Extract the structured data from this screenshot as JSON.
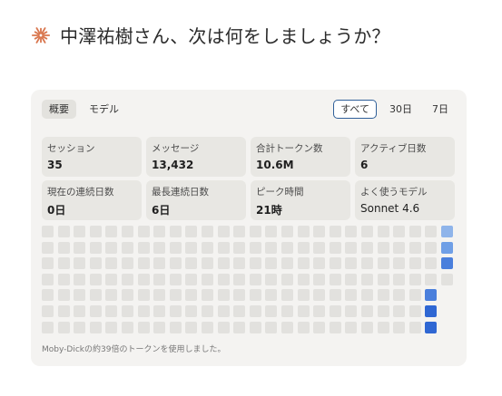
{
  "greeting": {
    "text": "中澤祐樹さん、次は何をしましょうか？",
    "icon": "claude-spark-icon",
    "icon_color": "#d9774f"
  },
  "tabs": {
    "overview": "概要",
    "models": "モデル"
  },
  "ranges": {
    "all": "すべて",
    "days30": "30日",
    "days7": "7日",
    "selected": "all"
  },
  "stats": {
    "sessions": {
      "label": "セッション",
      "value": "35"
    },
    "messages": {
      "label": "メッセージ",
      "value": "13,432"
    },
    "tokens": {
      "label": "合計トークン数",
      "value": "10.6M"
    },
    "active_days": {
      "label": "アクティブ日数",
      "value": "6"
    },
    "current_streak": {
      "label": "現在の連続日数",
      "value": "0日"
    },
    "longest_streak": {
      "label": "最長連続日数",
      "value": "6日"
    },
    "peak_hour": {
      "label": "ピーク時間",
      "value": "21時"
    },
    "favorite_model": {
      "label": "よく使うモデル",
      "value": "Sonnet 4.6"
    }
  },
  "heatmap": {
    "weeks": 26,
    "rows": 7,
    "empty_color": "#e2e1de",
    "active_cells": [
      {
        "week": 25,
        "day": 0,
        "level": 2
      },
      {
        "week": 25,
        "day": 1,
        "level": 3
      },
      {
        "week": 25,
        "day": 2,
        "level": 4
      },
      {
        "week": 24,
        "day": 4,
        "level": 4
      },
      {
        "week": 24,
        "day": 5,
        "level": 5
      },
      {
        "week": 24,
        "day": 6,
        "level": 5
      }
    ],
    "missing_cells": [
      {
        "week": 25,
        "day": 4
      },
      {
        "week": 25,
        "day": 5
      },
      {
        "week": 25,
        "day": 6
      }
    ],
    "level_colors": {
      "2": "#8fb4ea",
      "3": "#6f9fe6",
      "4": "#4a7fdc",
      "5": "#2f67d3"
    }
  },
  "footer": "Moby-Dickの約39倍のトークンを使用しました。"
}
